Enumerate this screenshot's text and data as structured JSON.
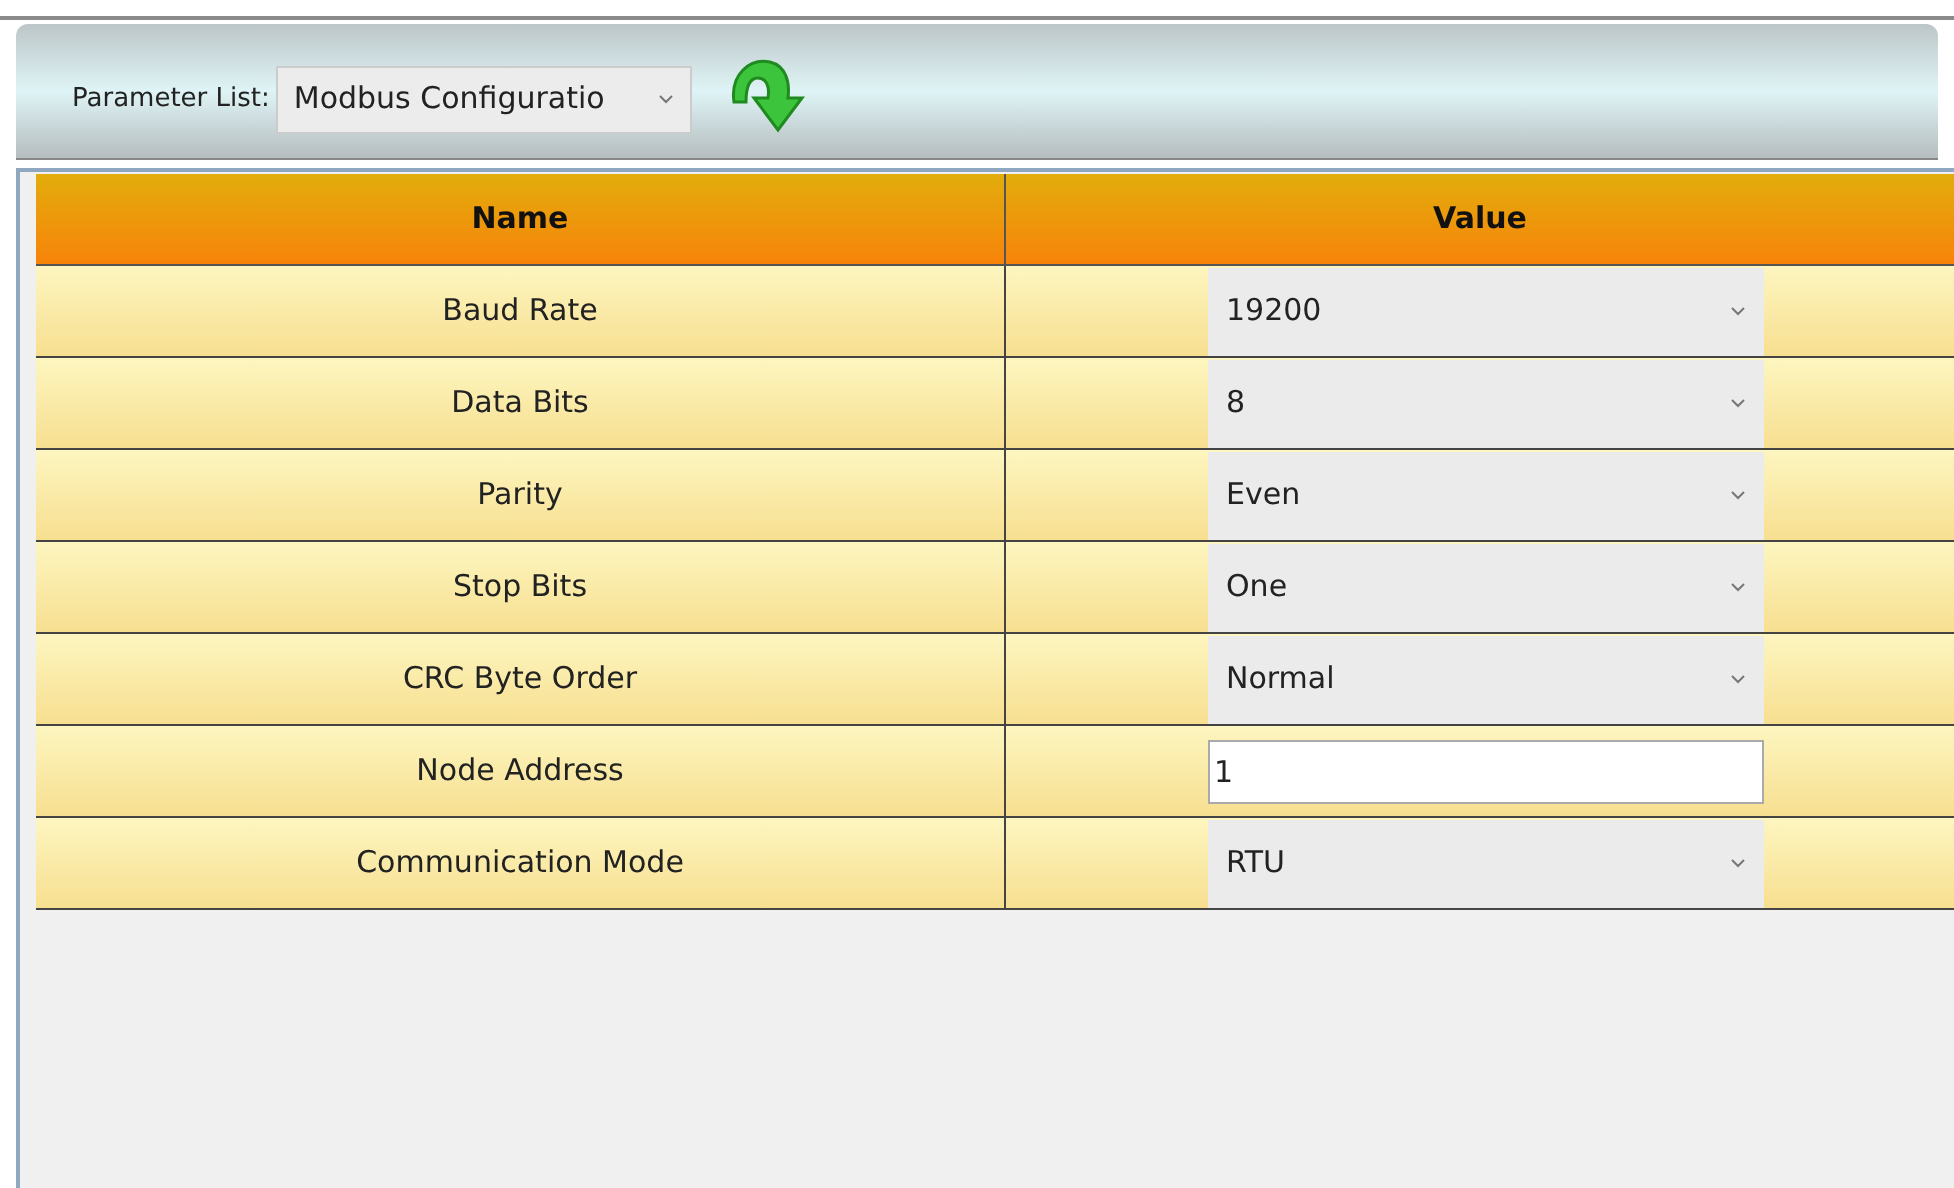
{
  "toolbar": {
    "label": "Parameter List:",
    "selector": {
      "value": "Modbus Configuratio"
    }
  },
  "table": {
    "columns": [
      "Name",
      "Value"
    ],
    "rows": [
      {
        "name": "Baud Rate",
        "kind": "select",
        "value": "19200"
      },
      {
        "name": "Data Bits",
        "kind": "select",
        "value": "8"
      },
      {
        "name": "Parity",
        "kind": "select",
        "value": "Even"
      },
      {
        "name": "Stop Bits",
        "kind": "select",
        "value": "One"
      },
      {
        "name": "CRC Byte Order",
        "kind": "select",
        "value": "Normal"
      },
      {
        "name": "Node Address",
        "kind": "text",
        "value": "1"
      },
      {
        "name": "Communication Mode",
        "kind": "select",
        "value": "RTU"
      }
    ]
  }
}
